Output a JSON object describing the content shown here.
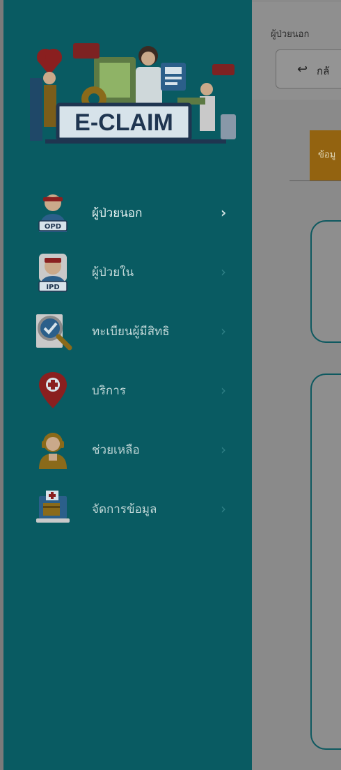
{
  "app": {
    "logo_text": "E-CLAIM"
  },
  "sidebar": {
    "items": [
      {
        "label": "ผู้ป่วยนอก",
        "icon": "opd-patient-icon",
        "badge": "OPD",
        "active": true
      },
      {
        "label": "ผู้ป่วยใน",
        "icon": "ipd-patient-icon",
        "badge": "IPD",
        "active": false
      },
      {
        "label": "ทะเบียนผู้มีสิทธิ",
        "icon": "registry-check-icon",
        "active": false
      },
      {
        "label": "บริการ",
        "icon": "service-pin-icon",
        "active": false
      },
      {
        "label": "ช่วยเหลือ",
        "icon": "helpdesk-agent-icon",
        "active": false
      },
      {
        "label": "จัดการข้อมูล",
        "icon": "data-management-icon",
        "active": false
      }
    ]
  },
  "header": {
    "breadcrumb": "ผู้ป่วยนอก",
    "back_button_label": "กลั"
  },
  "main": {
    "active_tab_label": "ข้อมู"
  },
  "colors": {
    "sidebar_bg": "#095b62",
    "overlay_content": "#8a8a8a",
    "tab_active": "#936310",
    "card_border": "#0e5960"
  }
}
